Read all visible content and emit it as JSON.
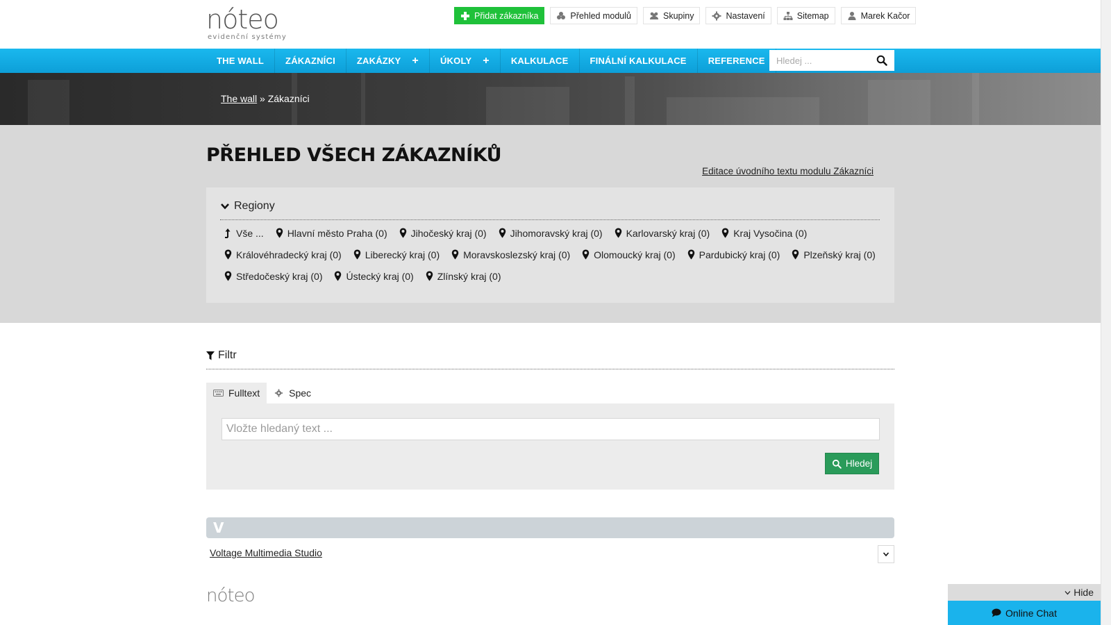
{
  "brand": {
    "logo_text": "nóteo",
    "logo_subtitle": "evidenční systémy",
    "footer_logo_text": "nóteo",
    "accent_color": "#1ab8ee",
    "green_color": "#1fc13a"
  },
  "top_actions": [
    {
      "label": "Přidat zákazníka",
      "icon": "plus-icon"
    },
    {
      "label": "Přehled modulů",
      "icon": "modules-icon"
    },
    {
      "label": "Skupiny",
      "icon": "users-icon"
    },
    {
      "label": "Nastavení",
      "icon": "gear-icon"
    },
    {
      "label": "Sitemap",
      "icon": "sitemap-icon"
    },
    {
      "label": "Marek Kačor",
      "icon": "user-icon"
    }
  ],
  "nav": {
    "items": [
      {
        "label": "THE WALL"
      },
      {
        "label": "ZÁKAZNÍCI"
      },
      {
        "label": "ZAKÁZKY",
        "plus": "+"
      },
      {
        "label": "ÚKOLY",
        "plus": "+"
      },
      {
        "label": "KALKULACE"
      },
      {
        "label": "FINÁLNÍ KALKULACE"
      },
      {
        "label": "REFERENCE"
      }
    ],
    "search_placeholder": "Hledej ..."
  },
  "breadcrumb": {
    "home": "The wall",
    "separator": "»",
    "current": "Zákazníci"
  },
  "page": {
    "title": "PŘEHLED VŠECH ZÁKAZNÍKŮ",
    "edit_link": "Editace úvodního textu modulu Zákazníci"
  },
  "regions": {
    "heading": "Regiony",
    "items": [
      "Vše ...",
      "Hlavní město Praha (0)",
      "Jihočeský kraj (0)",
      "Jihomoravský kraj (0)",
      "Karlovarský kraj (0)",
      "Kraj Vysočina (0)",
      "Královéhradecký kraj (0)",
      "Liberecký kraj (0)",
      "Moravskoslezský kraj (0)",
      "Olomoucký kraj (0)",
      "Pardubický kraj (0)",
      "Plzeňský kraj (0)",
      "Středočeský kraj (0)",
      "Ústecký kraj (0)",
      "Zlínský kraj (0)"
    ]
  },
  "filter": {
    "heading": "Filtr",
    "tabs": [
      {
        "label": "Fulltext",
        "icon": "keyboard-icon"
      },
      {
        "label": "Spec",
        "icon": "gear-icon"
      }
    ],
    "input_placeholder": "Vložte hledaný text ...",
    "search_button": "Hledej"
  },
  "customers": {
    "letter": "V",
    "items": [
      "Voltage Multimedia Studio"
    ]
  },
  "chat": {
    "hide_label": "Hide",
    "button_label": "Online Chat"
  }
}
